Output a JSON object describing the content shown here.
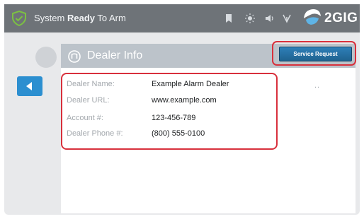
{
  "status_bar": {
    "status_prefix": "System ",
    "status_bold": "Ready",
    "status_suffix": " To Arm",
    "brand": "2GIG",
    "icons": [
      "shield-check-icon",
      "bookmark-icon",
      "brightness-icon",
      "volume-icon",
      "wifi-signal-icon"
    ]
  },
  "panel": {
    "title": "Dealer Info",
    "service_request_label": "Service Request",
    "more_indicator": ".."
  },
  "dealer_info": [
    {
      "label": "Dealer Name:",
      "value": "Example Alarm Dealer"
    },
    {
      "label": "Dealer URL:",
      "value": "www.example.com"
    },
    {
      "label": "Account #:",
      "value": "123-456-789"
    },
    {
      "label": "Dealer Phone #:",
      "value": "(800) 555-0100"
    }
  ],
  "colors": {
    "top_bar": "#6e7378",
    "accent_blue": "#2c8fd0",
    "highlight_red": "#d8303c",
    "shield_green": "#7cc142"
  }
}
